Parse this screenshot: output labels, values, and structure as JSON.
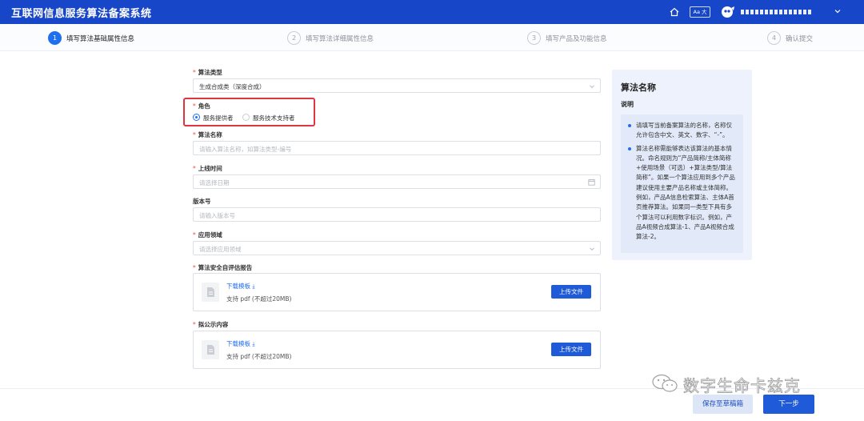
{
  "app": {
    "title": "互联网信息服务算法备案系统"
  },
  "header": {
    "font_toggle": "Aa 大",
    "icons": [
      "home-icon",
      "avatar-icon",
      "chevron-down-icon"
    ]
  },
  "steps": [
    {
      "num": "1",
      "label": "填写算法基础属性信息",
      "active": true
    },
    {
      "num": "2",
      "label": "填写算法详细属性信息",
      "active": false
    },
    {
      "num": "3",
      "label": "填写产品及功能信息",
      "active": false
    },
    {
      "num": "4",
      "label": "确认提交",
      "active": false
    }
  ],
  "form": {
    "algorithm_type": {
      "label": "算法类型",
      "value": "生成合成类（深度合成）"
    },
    "role": {
      "label": "角色",
      "options": [
        "服务提供者",
        "服务技术支持者"
      ],
      "selected": "服务提供者"
    },
    "algorithm_name": {
      "label": "算法名称",
      "placeholder": "请输入算法名称，如算法类型-编号"
    },
    "launch_time": {
      "label": "上线时间",
      "placeholder": "请选择日期"
    },
    "version": {
      "label": "版本号",
      "placeholder": "请输入版本号"
    },
    "application_domain": {
      "label": "应用领域",
      "placeholder": "请选择应用领域"
    },
    "self_assessment": {
      "label": "算法安全自评估报告",
      "download": "下载模板 ⤓",
      "hint": "支持 pdf (不超过20MB)",
      "upload": "上传文件"
    },
    "public_content": {
      "label": "拟公示内容",
      "download": "下载模板 ⤓",
      "hint": "支持 pdf (不超过20MB)",
      "upload": "上传文件"
    }
  },
  "help": {
    "title": "算法名称",
    "subtitle": "说明",
    "items": [
      "请填写当前备案算法的名称，名称仅允许包含中文、英文、数字、“-”。",
      "算法名称需能够表达该算法的基本情况。命名规则为“产品简称/主体简称+使用场景（可选）+算法类型/算法简称”。如果一个算法应用到多个产品建议使用主要产品名称或主体简称。例如，产品A信息检索算法、主体A首页推荐算法。如果同一类型下具有多个算法可以利用数字标识。例如，产品A视频合成算法-1、产品A视频合成算法-2。"
    ]
  },
  "footer": {
    "save_draft": "保存至草稿箱",
    "next": "下一步",
    "watermark": "数字生命卡兹克"
  },
  "colors": {
    "brand": "#1846c8",
    "accent": "#1f6ff0",
    "required": "#f0483e",
    "highlight_box": "#e0353e",
    "help_bg": "#edf2fc"
  }
}
